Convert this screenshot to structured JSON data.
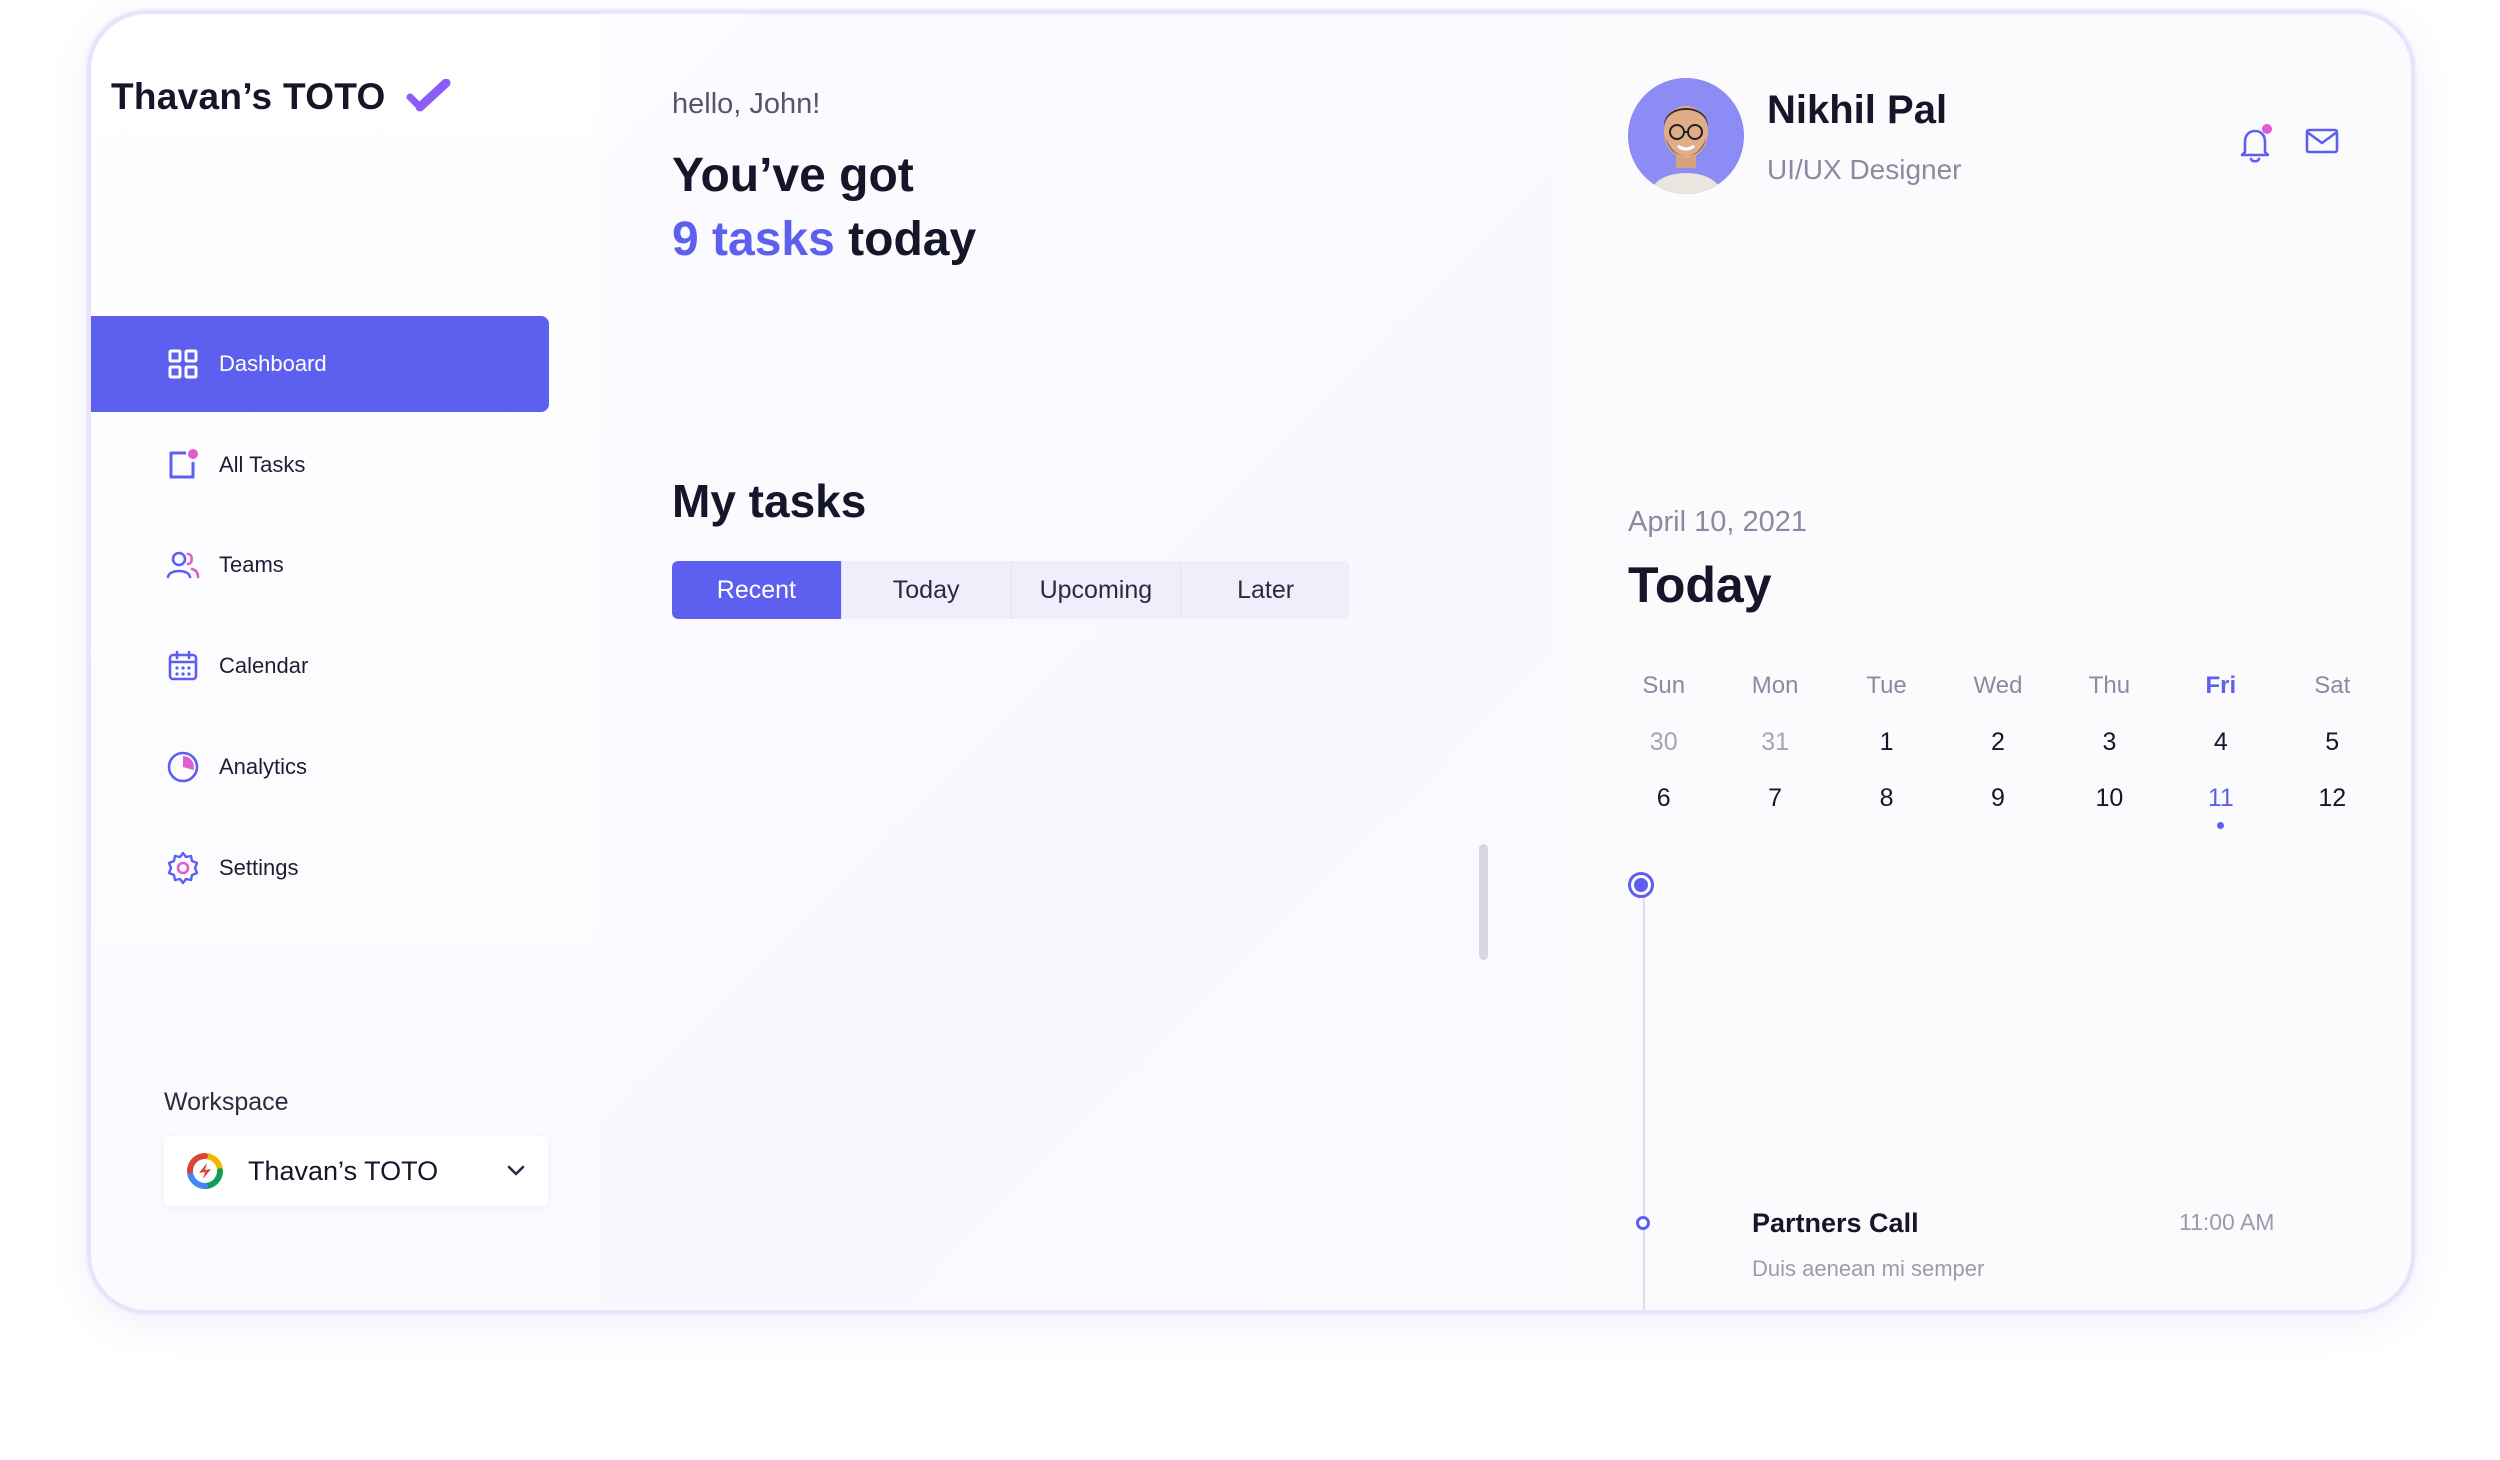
{
  "sidebar": {
    "brand": "Thavan’s TOTO",
    "items": [
      {
        "label": "Dashboard",
        "icon": "dashboard-grid-icon",
        "active": true
      },
      {
        "label": "All Tasks",
        "icon": "tasks-icon"
      },
      {
        "label": "Teams",
        "icon": "users-icon"
      },
      {
        "label": "Calendar",
        "icon": "calendar-icon"
      },
      {
        "label": "Analytics",
        "icon": "pie-chart-icon"
      },
      {
        "label": "Settings",
        "icon": "gear-icon"
      }
    ],
    "workspace_label": "Workspace",
    "workspace_value": "Thavan’s TOTO"
  },
  "main": {
    "greeting": "hello, John!",
    "headline_line1": "You’ve got",
    "headline_accent": "9 tasks",
    "headline_rest": "today",
    "section_title": "My tasks",
    "tabs": [
      {
        "label": "Recent",
        "active": true
      },
      {
        "label": "Today"
      },
      {
        "label": "Upcoming"
      },
      {
        "label": "Later"
      }
    ]
  },
  "profile": {
    "name": "Nikhil Pal",
    "role": "UI/UX Designer"
  },
  "schedule": {
    "date": "April 10, 2021",
    "title": "Today",
    "weekdays": [
      "Sun",
      "Mon",
      "Tue",
      "Wed",
      "Thu",
      "Fri",
      "Sat"
    ],
    "week1": [
      "30",
      "31",
      "1",
      "2",
      "3",
      "4",
      "5"
    ],
    "week2": [
      "6",
      "7",
      "8",
      "9",
      "10",
      "11",
      "12"
    ],
    "event": {
      "title": "Partners Call",
      "subtitle": "Duis aenean mi semper",
      "time": "11:00 AM"
    }
  },
  "colors": {
    "accent": "#5d5fef",
    "notification_dot": "#e05cd3"
  }
}
